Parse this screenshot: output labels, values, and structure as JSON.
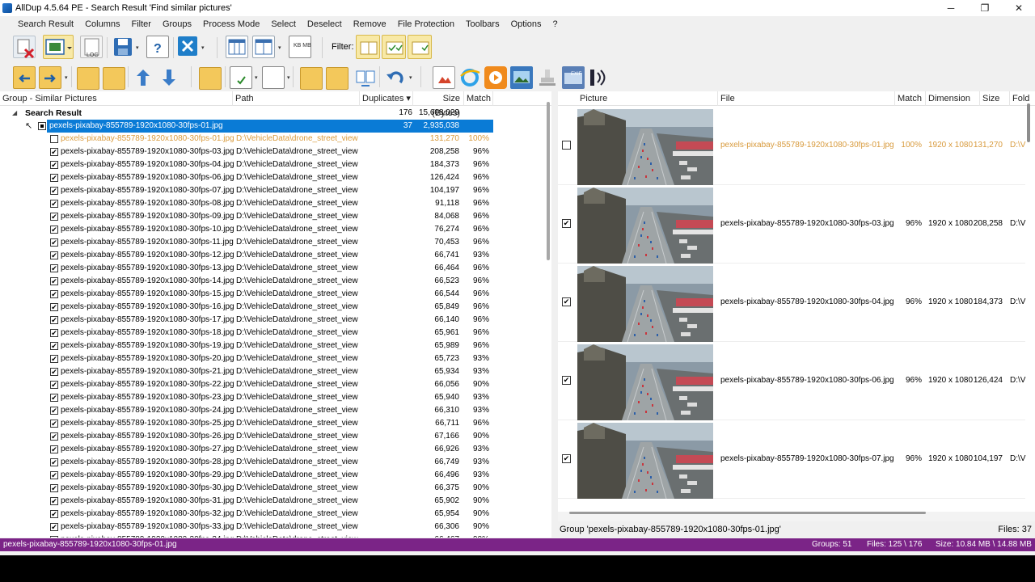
{
  "window": {
    "title": "AllDup 4.5.64 PE - Search Result 'Find similar pictures'",
    "controls": [
      "─",
      "❐",
      "✕"
    ]
  },
  "menu": [
    "Search Result",
    "Columns",
    "Filter",
    "Groups",
    "Process Mode",
    "Select",
    "Deselect",
    "Remove",
    "File Protection",
    "Toolbars",
    "Options",
    "?"
  ],
  "toolbar": {
    "filter_label": "Filter:",
    "log_label": "LOG",
    "kb_label": "KB MB",
    "exif_label": "EXIF"
  },
  "left": {
    "headers": {
      "group": "Group - Similar Pictures",
      "path": "Path",
      "duplicates": "Duplicates ▾",
      "size": "Size (Bytes)",
      "match": "Match"
    },
    "search_result": {
      "label": "Search Result",
      "duplicates": "176",
      "size": "15,608,029"
    },
    "group": {
      "name": "pexels-pixabay-855789-1920x1080-30fps-01.jpg",
      "duplicates": "37",
      "size": "2,935,038"
    },
    "rows": [
      {
        "file": "pexels-pixabay-855789-1920x1080-30fps-01.jpg",
        "path": "D:\\VehicleData\\drone_street_view",
        "size": "131,270",
        "match": "100%",
        "checked": false,
        "master": true
      },
      {
        "file": "pexels-pixabay-855789-1920x1080-30fps-03.jpg",
        "path": "D:\\VehicleData\\drone_street_view",
        "size": "208,258",
        "match": "96%",
        "checked": true
      },
      {
        "file": "pexels-pixabay-855789-1920x1080-30fps-04.jpg",
        "path": "D:\\VehicleData\\drone_street_view",
        "size": "184,373",
        "match": "96%",
        "checked": true
      },
      {
        "file": "pexels-pixabay-855789-1920x1080-30fps-06.jpg",
        "path": "D:\\VehicleData\\drone_street_view",
        "size": "126,424",
        "match": "96%",
        "checked": true
      },
      {
        "file": "pexels-pixabay-855789-1920x1080-30fps-07.jpg",
        "path": "D:\\VehicleData\\drone_street_view",
        "size": "104,197",
        "match": "96%",
        "checked": true
      },
      {
        "file": "pexels-pixabay-855789-1920x1080-30fps-08.jpg",
        "path": "D:\\VehicleData\\drone_street_view",
        "size": "91,118",
        "match": "96%",
        "checked": true
      },
      {
        "file": "pexels-pixabay-855789-1920x1080-30fps-09.jpg",
        "path": "D:\\VehicleData\\drone_street_view",
        "size": "84,068",
        "match": "96%",
        "checked": true
      },
      {
        "file": "pexels-pixabay-855789-1920x1080-30fps-10.jpg",
        "path": "D:\\VehicleData\\drone_street_view",
        "size": "76,274",
        "match": "96%",
        "checked": true
      },
      {
        "file": "pexels-pixabay-855789-1920x1080-30fps-11.jpg",
        "path": "D:\\VehicleData\\drone_street_view",
        "size": "70,453",
        "match": "96%",
        "checked": true
      },
      {
        "file": "pexels-pixabay-855789-1920x1080-30fps-12.jpg",
        "path": "D:\\VehicleData\\drone_street_view",
        "size": "66,741",
        "match": "93%",
        "checked": true
      },
      {
        "file": "pexels-pixabay-855789-1920x1080-30fps-13.jpg",
        "path": "D:\\VehicleData\\drone_street_view",
        "size": "66,464",
        "match": "96%",
        "checked": true
      },
      {
        "file": "pexels-pixabay-855789-1920x1080-30fps-14.jpg",
        "path": "D:\\VehicleData\\drone_street_view",
        "size": "66,523",
        "match": "96%",
        "checked": true
      },
      {
        "file": "pexels-pixabay-855789-1920x1080-30fps-15.jpg",
        "path": "D:\\VehicleData\\drone_street_view",
        "size": "66,544",
        "match": "96%",
        "checked": true
      },
      {
        "file": "pexels-pixabay-855789-1920x1080-30fps-16.jpg",
        "path": "D:\\VehicleData\\drone_street_view",
        "size": "65,849",
        "match": "96%",
        "checked": true
      },
      {
        "file": "pexels-pixabay-855789-1920x1080-30fps-17.jpg",
        "path": "D:\\VehicleData\\drone_street_view",
        "size": "66,140",
        "match": "96%",
        "checked": true
      },
      {
        "file": "pexels-pixabay-855789-1920x1080-30fps-18.jpg",
        "path": "D:\\VehicleData\\drone_street_view",
        "size": "65,961",
        "match": "96%",
        "checked": true
      },
      {
        "file": "pexels-pixabay-855789-1920x1080-30fps-19.jpg",
        "path": "D:\\VehicleData\\drone_street_view",
        "size": "65,989",
        "match": "96%",
        "checked": true
      },
      {
        "file": "pexels-pixabay-855789-1920x1080-30fps-20.jpg",
        "path": "D:\\VehicleData\\drone_street_view",
        "size": "65,723",
        "match": "93%",
        "checked": true
      },
      {
        "file": "pexels-pixabay-855789-1920x1080-30fps-21.jpg",
        "path": "D:\\VehicleData\\drone_street_view",
        "size": "65,934",
        "match": "93%",
        "checked": true
      },
      {
        "file": "pexels-pixabay-855789-1920x1080-30fps-22.jpg",
        "path": "D:\\VehicleData\\drone_street_view",
        "size": "66,056",
        "match": "90%",
        "checked": true
      },
      {
        "file": "pexels-pixabay-855789-1920x1080-30fps-23.jpg",
        "path": "D:\\VehicleData\\drone_street_view",
        "size": "65,940",
        "match": "93%",
        "checked": true
      },
      {
        "file": "pexels-pixabay-855789-1920x1080-30fps-24.jpg",
        "path": "D:\\VehicleData\\drone_street_view",
        "size": "66,310",
        "match": "93%",
        "checked": true
      },
      {
        "file": "pexels-pixabay-855789-1920x1080-30fps-25.jpg",
        "path": "D:\\VehicleData\\drone_street_view",
        "size": "66,711",
        "match": "96%",
        "checked": true
      },
      {
        "file": "pexels-pixabay-855789-1920x1080-30fps-26.jpg",
        "path": "D:\\VehicleData\\drone_street_view",
        "size": "67,166",
        "match": "90%",
        "checked": true
      },
      {
        "file": "pexels-pixabay-855789-1920x1080-30fps-27.jpg",
        "path": "D:\\VehicleData\\drone_street_view",
        "size": "66,926",
        "match": "93%",
        "checked": true
      },
      {
        "file": "pexels-pixabay-855789-1920x1080-30fps-28.jpg",
        "path": "D:\\VehicleData\\drone_street_view",
        "size": "66,749",
        "match": "93%",
        "checked": true
      },
      {
        "file": "pexels-pixabay-855789-1920x1080-30fps-29.jpg",
        "path": "D:\\VehicleData\\drone_street_view",
        "size": "66,496",
        "match": "93%",
        "checked": true
      },
      {
        "file": "pexels-pixabay-855789-1920x1080-30fps-30.jpg",
        "path": "D:\\VehicleData\\drone_street_view",
        "size": "66,375",
        "match": "90%",
        "checked": true
      },
      {
        "file": "pexels-pixabay-855789-1920x1080-30fps-31.jpg",
        "path": "D:\\VehicleData\\drone_street_view",
        "size": "65,902",
        "match": "90%",
        "checked": true
      },
      {
        "file": "pexels-pixabay-855789-1920x1080-30fps-32.jpg",
        "path": "D:\\VehicleData\\drone_street_view",
        "size": "65,954",
        "match": "90%",
        "checked": true
      },
      {
        "file": "pexels-pixabay-855789-1920x1080-30fps-33.jpg",
        "path": "D:\\VehicleData\\drone_street_view",
        "size": "66,306",
        "match": "90%",
        "checked": true
      },
      {
        "file": "pexels-pixabay-855789-1920x1080-30fps-34.jpg",
        "path": "D:\\VehicleData\\drone_street_view",
        "size": "66,467",
        "match": "90%",
        "checked": true
      }
    ]
  },
  "right": {
    "headers": {
      "picture": "Picture",
      "file": "File",
      "match": "Match",
      "dimension": "Dimension",
      "size": "Size",
      "folder": "Fold"
    },
    "rows": [
      {
        "file": "pexels-pixabay-855789-1920x1080-30fps-01.jpg",
        "match": "100%",
        "dimension": "1920 x 1080",
        "size": "131,270",
        "folder": "D:\\V",
        "checked": false,
        "master": true
      },
      {
        "file": "pexels-pixabay-855789-1920x1080-30fps-03.jpg",
        "match": "96%",
        "dimension": "1920 x 1080",
        "size": "208,258",
        "folder": "D:\\V",
        "checked": true
      },
      {
        "file": "pexels-pixabay-855789-1920x1080-30fps-04.jpg",
        "match": "96%",
        "dimension": "1920 x 1080",
        "size": "184,373",
        "folder": "D:\\V",
        "checked": true
      },
      {
        "file": "pexels-pixabay-855789-1920x1080-30fps-06.jpg",
        "match": "96%",
        "dimension": "1920 x 1080",
        "size": "126,424",
        "folder": "D:\\V",
        "checked": true
      },
      {
        "file": "pexels-pixabay-855789-1920x1080-30fps-07.jpg",
        "match": "96%",
        "dimension": "1920 x 1080",
        "size": "104,197",
        "folder": "D:\\V",
        "checked": true
      }
    ],
    "group_label": "Group 'pexels-pixabay-855789-1920x1080-30fps-01.jpg'",
    "files_label": "Files: 37"
  },
  "status": {
    "current": "pexels-pixabay-855789-1920x1080-30fps-01.jpg",
    "groups": "Groups: 51",
    "files": "Files: 125 \\ 176",
    "size": "Size: 10.84 MB \\ 14.88 MB"
  },
  "colors": {
    "selection": "#0a7bd6",
    "master_text": "#d89a3c",
    "status_bar": "#7b2487",
    "highlight_button": "#f8e9a6"
  }
}
